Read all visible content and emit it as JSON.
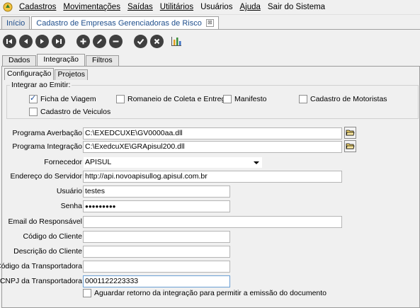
{
  "menu": {
    "items": [
      "Cadastros",
      "Movimentações",
      "Saídas",
      "Utilitários",
      "Usuários",
      "Ajuda",
      "Sair do Sistema"
    ]
  },
  "doc_tabs": {
    "home": "Início",
    "current": "Cadastro de Empresas Gerenciadoras de Risco",
    "close_glyph": "⊠"
  },
  "toolbar": {
    "icons": [
      "first-icon",
      "previous-icon",
      "next-icon",
      "last-icon",
      "add-icon",
      "edit-icon",
      "delete-icon",
      "confirm-icon",
      "cancel-icon",
      "chart-icon"
    ]
  },
  "main_tabs": [
    "Dados",
    "Integração",
    "Filtros"
  ],
  "sub_tabs": [
    "Configuração",
    "Projetos"
  ],
  "emit_group": {
    "title": "Integrar ao Emitir:",
    "options": [
      {
        "label": "Ficha de Viagem",
        "checked": true
      },
      {
        "label": "Romaneio de Coleta e Entrega",
        "checked": false
      },
      {
        "label": "Manifesto",
        "checked": false
      },
      {
        "label": "Cadastro de Motoristas",
        "checked": false
      },
      {
        "label": "Cadastro de Veiculos",
        "checked": false
      }
    ]
  },
  "form": {
    "programa_averbacao": {
      "label": "Programa Averbação",
      "value": "C:\\EXEDCUXE\\GV0000aa.dll"
    },
    "programa_integracao": {
      "label": "Programa Integração",
      "value": "C:\\ExedcuXE\\GRApisul200.dll"
    },
    "fornecedor": {
      "label": "Fornecedor",
      "value": "APISUL"
    },
    "endereco_servidor": {
      "label": "Endereço do Servidor",
      "value": "http://api.novoapisullog.apisul.com.br"
    },
    "usuario": {
      "label": "Usuário",
      "value": "testes"
    },
    "senha": {
      "label": "Senha",
      "value": "●●●●●●●●●"
    },
    "email_responsavel": {
      "label": "Email do Responsável",
      "value": ""
    },
    "codigo_cliente": {
      "label": "Código do Cliente",
      "value": ""
    },
    "descricao_cliente": {
      "label": "Descrição do Cliente",
      "value": ""
    },
    "codigo_transportadora": {
      "label": "Código da Transportadora",
      "value": ""
    },
    "cnpj_transportadora": {
      "label": "CNPJ da Transportadora",
      "value": "0001122223333"
    },
    "aguardar_retorno": {
      "label": "Aguardar retorno da integração para permitir a emissão do documento",
      "checked": false
    }
  }
}
